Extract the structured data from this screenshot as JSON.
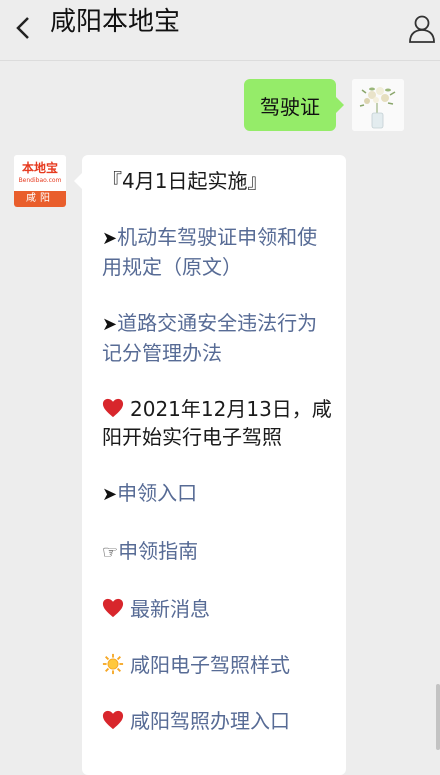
{
  "header": {
    "title": "咸阳本地宝",
    "back_icon": "chevron-left-icon",
    "profile_icon": "person-icon"
  },
  "outgoing": {
    "text": "驾驶证"
  },
  "bot": {
    "logo_main": "本地宝",
    "logo_sub": "Bendibao.com",
    "logo_city": "咸阳"
  },
  "incoming": {
    "header_line": "『4月1日起实施』",
    "link1_arrow": "➤",
    "link1_text_a": "机动车驾驶证申领和使",
    "link1_text_b": "用规定（原文）",
    "link2_arrow": "➤",
    "link2_text_a": "道路交通安全违法行为",
    "link2_text_b": "记分管理办法",
    "notice_line_a": "2021年12月13日，咸",
    "notice_line_b": "阳开始实行电子驾照",
    "link3_arrow": "➤",
    "link3_text": "申领入口",
    "link4_hand": "☞",
    "link4_text": "申领指南",
    "link5_text": "最新消息",
    "link6_text": "咸阳电子驾照样式",
    "link7_text": "咸阳驾照办理入口"
  },
  "colors": {
    "link": "#576b95",
    "outgoing_bubble": "#95ec69",
    "background": "#ededed"
  }
}
